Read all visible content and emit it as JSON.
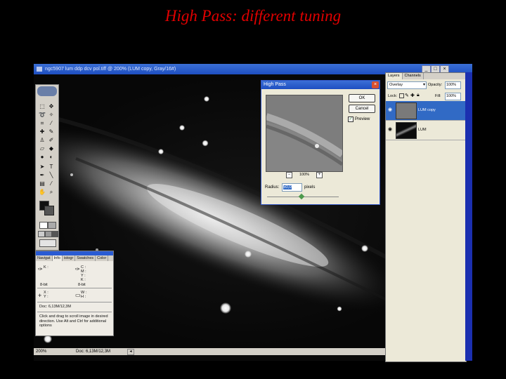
{
  "slide_title": "High Pass: different tuning",
  "window": {
    "title": "ngc5907 lum ddp dcv pol.tiff @ 200% (LUM copy, Gray/16#)",
    "buttons": [
      "_",
      "□",
      "×"
    ]
  },
  "status": {
    "zoom": "200%",
    "doc": "Doc: 6,13M/12,3M"
  },
  "high_pass": {
    "title": "High Pass",
    "ok": "OK",
    "cancel": "Cancel",
    "preview_label": "Preview",
    "preview_checked": true,
    "zoom": "100%",
    "zoom_minus": "−",
    "zoom_plus": "+",
    "radius_label": "Radius:",
    "radius_value": "50,0",
    "radius_unit": "pixels",
    "close": "×"
  },
  "layers": {
    "tabs": [
      "Layers",
      "Channels"
    ],
    "blend_mode": "Overlay",
    "opacity_label": "Opacity:",
    "opacity_value": "100%",
    "lock_label": "Lock:",
    "fill_label": "Fill:",
    "fill_value": "100%",
    "items": [
      {
        "name": "LUM copy",
        "selected": true
      },
      {
        "name": "LUM",
        "selected": false
      }
    ]
  },
  "info_palette": {
    "tabs": [
      "Navigat",
      "Info",
      "istogr",
      "Swatches",
      "Color"
    ],
    "active_tab": "Info",
    "k_label": "K :",
    "c_label": "C :",
    "m_label": "M :",
    "y_label": "Y :",
    "k2_label": "K :",
    "bit1": "8-bit",
    "bit2": "8-bit",
    "x_label": "X :",
    "yy_label": "Y :",
    "w_label": "W :",
    "h_label": "H :",
    "doc": "Doc: 6,13M/12,3M",
    "hint": "Click and drag to scroll image in desired direction. Use Alt and Ctrl for additional options"
  },
  "colors": {
    "title_red": "#e00000",
    "titlebar_blue": "#2455c8",
    "selected_layer": "#316ac5"
  }
}
